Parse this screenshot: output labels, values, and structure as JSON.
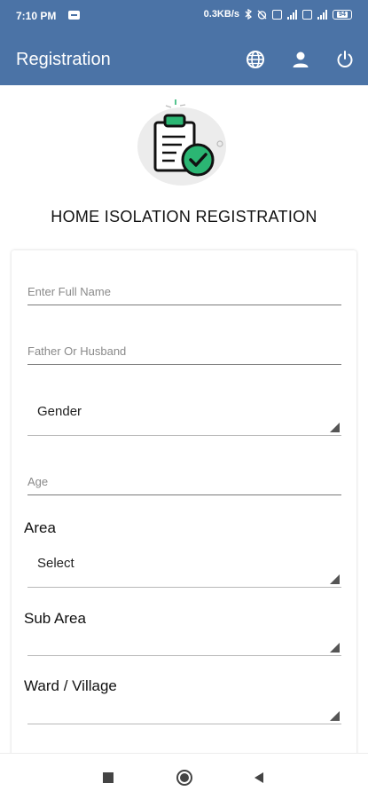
{
  "status_bar": {
    "time": "7:10 PM",
    "speed": "0.3KB/s",
    "battery": "94"
  },
  "app_bar": {
    "title": "Registration",
    "actions": [
      "globe-icon",
      "person-icon",
      "power-icon"
    ]
  },
  "header": {
    "heading": "HOME ISOLATION REGISTRATION"
  },
  "form": {
    "full_name": {
      "placeholder": "Enter Full Name",
      "value": ""
    },
    "father_husband": {
      "placeholder": "Father Or Husband",
      "value": ""
    },
    "gender": {
      "selected": "Gender"
    },
    "age": {
      "placeholder": "Age",
      "value": ""
    },
    "area": {
      "label": "Area",
      "selected": "Select"
    },
    "sub_area": {
      "label": "Sub Area",
      "selected": ""
    },
    "ward_village": {
      "label": "Ward / Village",
      "selected": ""
    }
  },
  "colors": {
    "primary": "#4b73a6",
    "accent_green": "#2bb673"
  },
  "nav": [
    "recents-square-icon",
    "home-circle-icon",
    "back-triangle-icon"
  ]
}
